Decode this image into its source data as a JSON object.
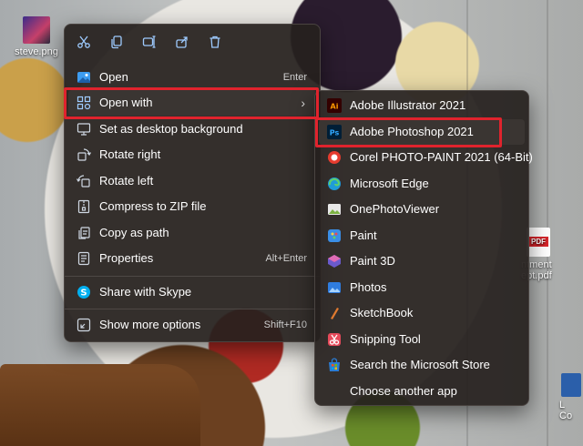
{
  "desktop": {
    "icons": [
      {
        "label": "steve.png"
      },
      {
        "label": "ntment\nept.pdf",
        "badge": "PDF"
      },
      {
        "label": "L\nCo"
      }
    ]
  },
  "context_menu": {
    "toolbar": [
      {
        "icon": "cut-icon"
      },
      {
        "icon": "copy-icon"
      },
      {
        "icon": "rename-icon"
      },
      {
        "icon": "share-icon"
      },
      {
        "icon": "delete-icon"
      }
    ],
    "items": [
      {
        "label": "Open",
        "shortcut": "Enter",
        "icon": "image-icon"
      },
      {
        "label": "Open with",
        "icon": "open-with-icon",
        "has_submenu": true
      },
      {
        "label": "Set as desktop background",
        "icon": "desktop-background-icon"
      },
      {
        "label": "Rotate right",
        "icon": "rotate-right-icon"
      },
      {
        "label": "Rotate left",
        "icon": "rotate-left-icon"
      },
      {
        "label": "Compress to ZIP file",
        "icon": "zip-icon"
      },
      {
        "label": "Copy as path",
        "icon": "copy-path-icon"
      },
      {
        "label": "Properties",
        "shortcut": "Alt+Enter",
        "icon": "properties-icon"
      },
      {
        "label": "Share with Skype",
        "icon": "skype-icon"
      },
      {
        "label": "Show more options",
        "shortcut": "Shift+F10",
        "icon": "more-options-icon"
      }
    ]
  },
  "open_with_submenu": {
    "items": [
      {
        "label": "Adobe Illustrator 2021",
        "icon": "illustrator-icon",
        "glyph": "Ai",
        "color": "#ff9a00",
        "bg": "#330000"
      },
      {
        "label": "Adobe Photoshop 2021",
        "icon": "photoshop-icon",
        "glyph": "Ps",
        "color": "#31a8ff",
        "bg": "#001e36"
      },
      {
        "label": "Corel PHOTO-PAINT 2021 (64-Bit)",
        "icon": "corel-icon",
        "color": "#e63c2f"
      },
      {
        "label": "Microsoft Edge",
        "icon": "edge-icon",
        "color": "#1f9bd7"
      },
      {
        "label": "OnePhotoViewer",
        "icon": "photo-viewer-icon",
        "color": "#7cb342"
      },
      {
        "label": "Paint",
        "icon": "paint-icon",
        "color": "#3a8ee6"
      },
      {
        "label": "Paint 3D",
        "icon": "paint3d-icon",
        "color": "#6a5acd"
      },
      {
        "label": "Photos",
        "icon": "photos-icon",
        "color": "#2f7de0"
      },
      {
        "label": "SketchBook",
        "icon": "sketchbook-icon",
        "color": "#e07a2f"
      },
      {
        "label": "Snipping Tool",
        "icon": "snipping-tool-icon",
        "color": "#e64a5a"
      },
      {
        "label": "Search the Microsoft Store",
        "icon": "store-icon",
        "color": "#2b7cd3"
      },
      {
        "label": "Choose another app",
        "icon": "",
        "color": ""
      }
    ]
  },
  "highlight_color": "#e0232d"
}
